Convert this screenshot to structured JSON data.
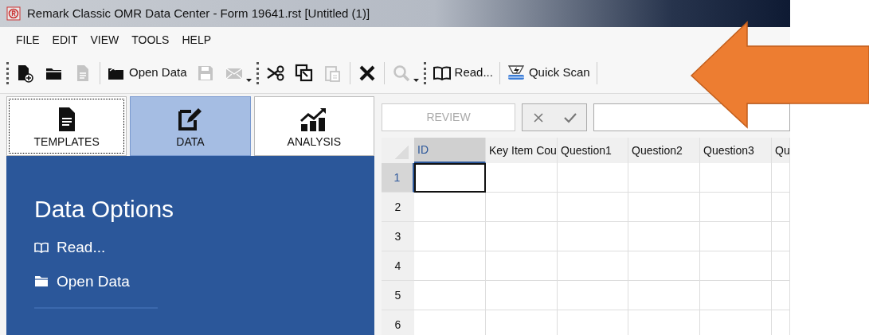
{
  "window": {
    "title": "Remark Classic OMR Data Center - Form 19641.rst [Untitled (1)]"
  },
  "menu": [
    {
      "label": "FILE"
    },
    {
      "label": "EDIT"
    },
    {
      "label": "VIEW"
    },
    {
      "label": "TOOLS"
    },
    {
      "label": "HELP"
    }
  ],
  "toolbar": [
    {
      "kind": "grip"
    },
    {
      "kind": "tool",
      "disabled": false
    },
    {
      "kind": "tool",
      "disabled": false
    },
    {
      "kind": "tool",
      "disabled": true
    },
    {
      "kind": "separator"
    },
    {
      "kind": "tool",
      "disabled": false,
      "label": "Open Data"
    },
    {
      "kind": "tool",
      "disabled": true
    },
    {
      "kind": "tool",
      "disabled": true
    },
    {
      "kind": "dropdown"
    },
    {
      "kind": "grip"
    },
    {
      "kind": "tool",
      "disabled": false
    },
    {
      "kind": "tool",
      "disabled": false
    },
    {
      "kind": "tool",
      "disabled": true
    },
    {
      "kind": "separator"
    },
    {
      "kind": "tool",
      "disabled": false
    },
    {
      "kind": "separator"
    },
    {
      "kind": "tool",
      "disabled": true
    },
    {
      "kind": "dropdown"
    },
    {
      "kind": "grip"
    },
    {
      "kind": "tool",
      "disabled": false,
      "label": "Read..."
    },
    {
      "kind": "separator"
    },
    {
      "kind": "tool",
      "disabled": false,
      "label": "Quick Scan"
    },
    {
      "kind": "separator"
    }
  ],
  "nav_tabs": [
    {
      "label": "TEMPLATES",
      "selected": false
    },
    {
      "label": "DATA",
      "selected": true
    },
    {
      "label": "ANALYSIS",
      "selected": false
    }
  ],
  "panel": {
    "title": "Data Options",
    "items": [
      {
        "label": "Read..."
      },
      {
        "label": "Open Data"
      }
    ]
  },
  "review_bar": {
    "review_button": {
      "label": "REVIEW",
      "disabled": true
    }
  },
  "grid": {
    "columns": [
      {
        "label": "ID",
        "selected": true
      },
      {
        "label": "Key Item Cou",
        "selected": false
      },
      {
        "label": "Question1",
        "selected": false
      },
      {
        "label": "Question2",
        "selected": false
      },
      {
        "label": "Question3",
        "selected": false
      },
      {
        "label": "Qu",
        "selected": false
      }
    ],
    "rows": [
      {
        "label": "1",
        "selected": true
      },
      {
        "label": "2",
        "selected": false
      },
      {
        "label": "3",
        "selected": false
      },
      {
        "label": "4",
        "selected": false
      },
      {
        "label": "5",
        "selected": false
      },
      {
        "label": "6",
        "selected": false
      }
    ]
  }
}
